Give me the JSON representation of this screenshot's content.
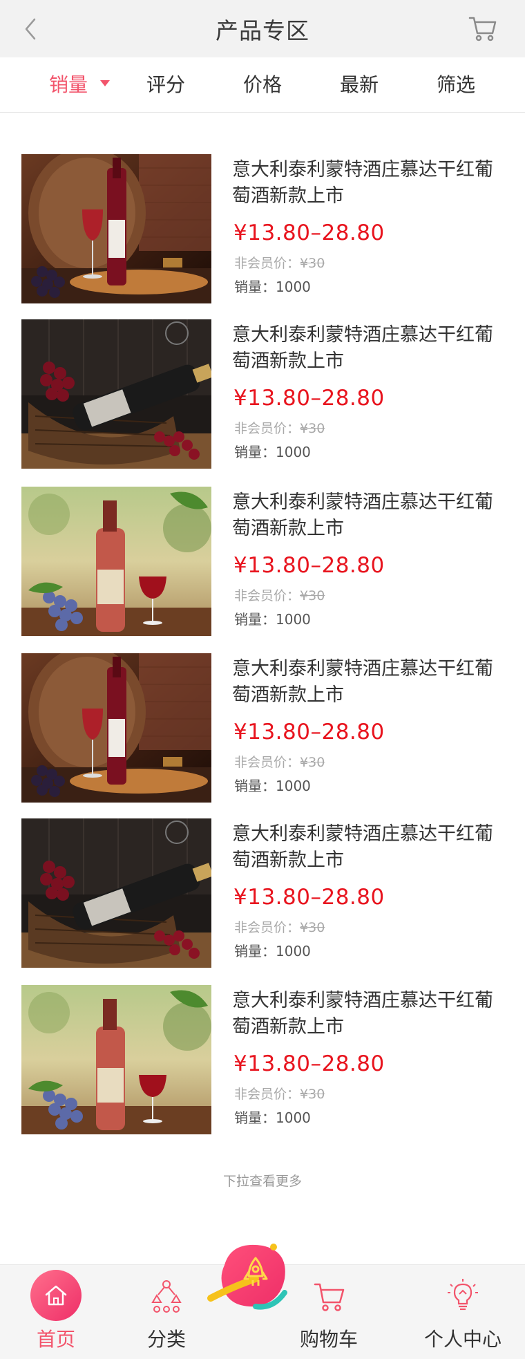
{
  "header": {
    "title": "产品专区"
  },
  "sort_tabs": [
    {
      "label": "销量"
    },
    {
      "label": "评分"
    },
    {
      "label": "价格"
    },
    {
      "label": "最新"
    },
    {
      "label": "筛选"
    }
  ],
  "products": [
    {
      "title": "意大利泰利蒙特酒庄慕达干红葡萄酒新款上市",
      "price": "¥13.80–28.80",
      "member_label": "非会员价：",
      "member_price": "¥30",
      "sales": "销量：1000"
    },
    {
      "title": "意大利泰利蒙特酒庄慕达干红葡萄酒新款上市",
      "price": "¥13.80–28.80",
      "member_label": "非会员价：",
      "member_price": "¥30",
      "sales": "销量：1000"
    },
    {
      "title": "意大利泰利蒙特酒庄慕达干红葡萄酒新款上市",
      "price": "¥13.80–28.80",
      "member_label": "非会员价：",
      "member_price": "¥30",
      "sales": "销量：1000"
    },
    {
      "title": "意大利泰利蒙特酒庄慕达干红葡萄酒新款上市",
      "price": "¥13.80–28.80",
      "member_label": "非会员价：",
      "member_price": "¥30",
      "sales": "销量：1000"
    },
    {
      "title": "意大利泰利蒙特酒庄慕达干红葡萄酒新款上市",
      "price": "¥13.80–28.80",
      "member_label": "非会员价：",
      "member_price": "¥30",
      "sales": "销量：1000"
    },
    {
      "title": "意大利泰利蒙特酒庄慕达干红葡萄酒新款上市",
      "price": "¥13.80–28.80",
      "member_label": "非会员价：",
      "member_price": "¥30",
      "sales": "销量：1000"
    }
  ],
  "more_hint": "下拉查看更多",
  "bottom_nav": [
    {
      "label": "首页",
      "icon": "home-icon"
    },
    {
      "label": "分类",
      "icon": "category-icon"
    },
    {
      "label": "购物车",
      "icon": "cart-icon"
    },
    {
      "label": "个人中心",
      "icon": "lightbulb-icon"
    }
  ],
  "colors": {
    "accent": "#f2546b",
    "price": "#e8141e",
    "header_bg": "#f2f2f2"
  }
}
